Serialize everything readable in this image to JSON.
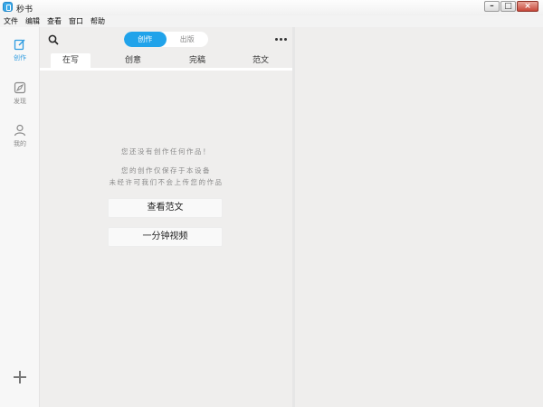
{
  "window": {
    "title": "秒书"
  },
  "menu": [
    "文件",
    "编辑",
    "查看",
    "窗口",
    "帮助"
  ],
  "rail": {
    "items": [
      {
        "label": "创作",
        "icon": "edit-icon",
        "active": true
      },
      {
        "label": "发现",
        "icon": "compass-icon",
        "active": false
      },
      {
        "label": "我的",
        "icon": "user-icon",
        "active": false
      }
    ],
    "add_icon": "plus-icon"
  },
  "header": {
    "segments": [
      {
        "label": "创作",
        "active": true
      },
      {
        "label": "出版",
        "active": false
      }
    ]
  },
  "tabs": [
    {
      "label": "在写",
      "active": true
    },
    {
      "label": "创意",
      "active": false
    },
    {
      "label": "完稿",
      "active": false
    },
    {
      "label": "范文",
      "active": false
    }
  ],
  "empty_state": {
    "line1": "您还没有创作任何作品！",
    "line2": "您的创作仅保存于本设备",
    "line3": "未经许可我们不会上传您的作品",
    "button_sample": "查看范文",
    "button_video": "一分钟视频"
  },
  "colors": {
    "accent": "#21a3ea",
    "panel_bg": "#efeeed",
    "rail_bg": "#f7f7f7"
  }
}
